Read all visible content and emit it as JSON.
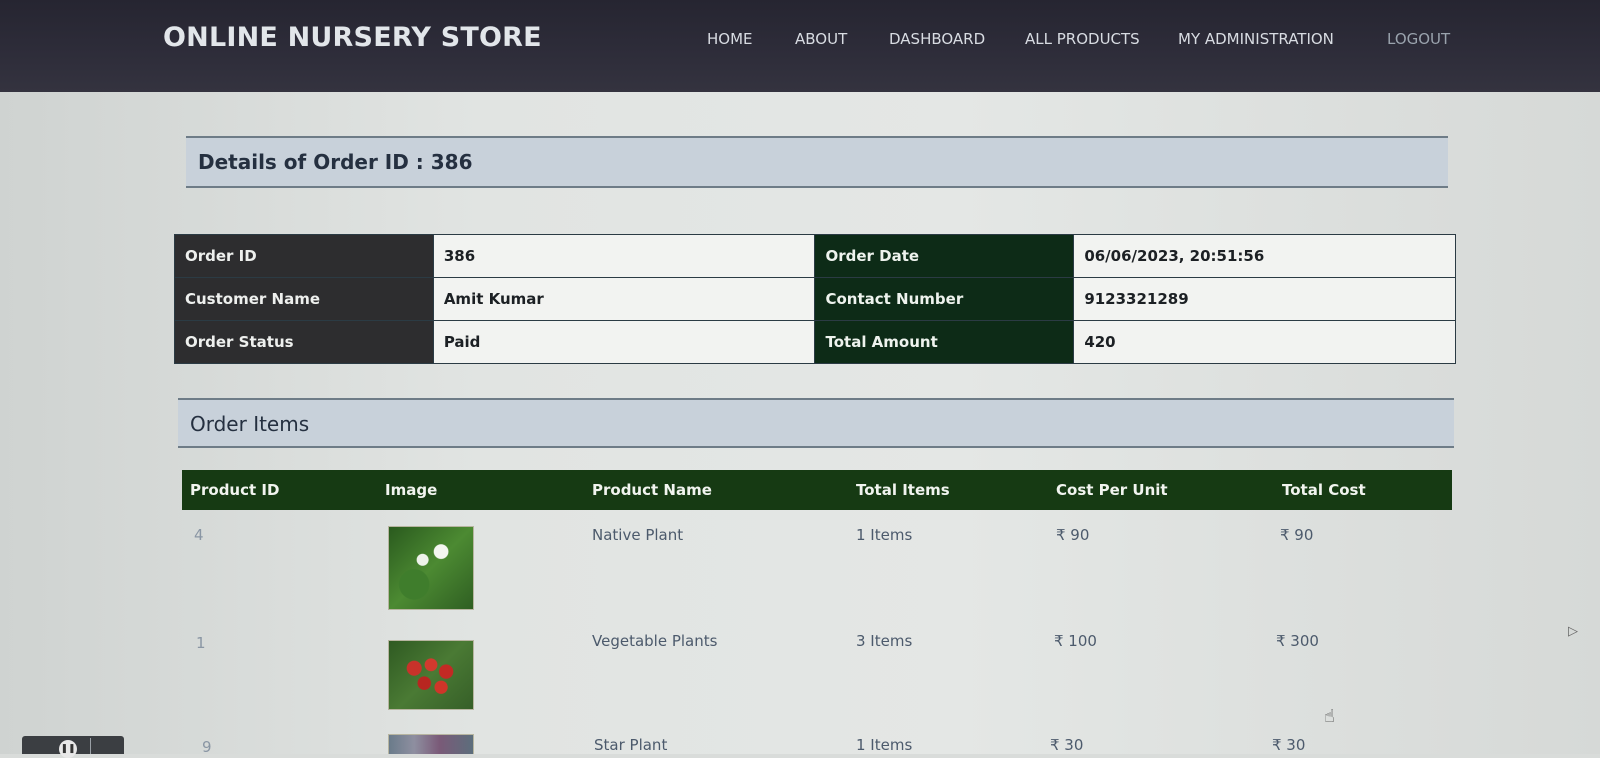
{
  "header": {
    "brand": "ONLINE NURSERY STORE",
    "nav": [
      "HOME",
      "ABOUT",
      "DASHBOARD",
      "ALL PRODUCTS",
      "MY ADMINISTRATION",
      "LOGOUT"
    ]
  },
  "page_title": "Details of Order ID : 386",
  "order_info": {
    "order_id_label": "Order ID",
    "order_id": "386",
    "order_date_label": "Order Date",
    "order_date": "06/06/2023, 20:51:56",
    "customer_name_label": "Customer Name",
    "customer_name": "Amit Kumar",
    "contact_label": "Contact Number",
    "contact": "9123321289",
    "status_label": "Order Status",
    "status": "Paid",
    "total_label": "Total Amount",
    "total": "420"
  },
  "items_section_title": "Order Items",
  "items_columns": [
    "Product ID",
    "Image",
    "Product Name",
    "Total Items",
    "Cost Per Unit",
    "Total Cost"
  ],
  "items": [
    {
      "id": "4",
      "name": "Native Plant",
      "qty": "1 Items",
      "unit": "₹ 90",
      "total": "₹ 90",
      "image": "white-flower-plant-image"
    },
    {
      "id": "1",
      "name": "Vegetable Plants",
      "qty": "3 Items",
      "unit": "₹ 100",
      "total": "₹ 300",
      "image": "tomato-plant-image"
    },
    {
      "id": "9",
      "name": "Star Plant",
      "qty": "1 Items",
      "unit": "₹ 30",
      "total": "₹ 30",
      "image": "star-plant-image"
    }
  ],
  "colors": {
    "navbar": "#2e2d3a",
    "label_dark": "#2d2d2f",
    "label_green": "#0d2b17",
    "items_header": "#163a13",
    "section_head": "#c8d1da"
  }
}
